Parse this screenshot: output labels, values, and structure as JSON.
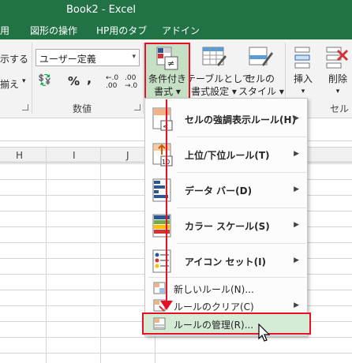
{
  "window": {
    "title": "Book2 - Excel"
  },
  "tabs": [
    "用",
    "図形の操作",
    "HP用のタブ",
    "アドイン"
  ],
  "ribbon": {
    "left_partial": [
      "示する",
      "揃え"
    ],
    "number_format_value": "ユーザー定義",
    "group_number_label": "数値",
    "group_cells_label": "セル",
    "percent": "%",
    "comma": ",",
    "cond_format_label": [
      "条件付き",
      "書式"
    ],
    "table_format_label": [
      "テーブルとして",
      "書式設定"
    ],
    "cell_style_label": [
      "セルの",
      "スタイル"
    ],
    "insert_label": "挿入",
    "delete_label": "削除"
  },
  "columns": [
    "H",
    "I",
    "J"
  ],
  "menu": {
    "items": [
      {
        "label": "セルの強調表示ルール(H)",
        "icon": "highlight-rules-icon",
        "submenu": true
      },
      {
        "label": "上位/下位ルール(T)",
        "icon": "top-bottom-rules-icon",
        "submenu": true
      },
      {
        "label": "データ バー(D)",
        "icon": "data-bars-icon",
        "submenu": true
      },
      {
        "label": "カラー スケール(S)",
        "icon": "color-scales-icon",
        "submenu": true
      },
      {
        "label": "アイコン セット(I)",
        "icon": "icon-sets-icon",
        "submenu": true
      }
    ],
    "small_items": [
      {
        "label": "新しいルール(N)...",
        "icon": "new-rule-icon",
        "submenu": false
      },
      {
        "label": "ルールのクリア(C)",
        "icon": "clear-rules-icon",
        "submenu": true
      },
      {
        "label": "ルールの管理(R)...",
        "icon": "manage-rules-icon",
        "submenu": false,
        "highlighted": true
      }
    ]
  },
  "colors": {
    "excel_green": "#217346",
    "highlight": "#e81123"
  }
}
